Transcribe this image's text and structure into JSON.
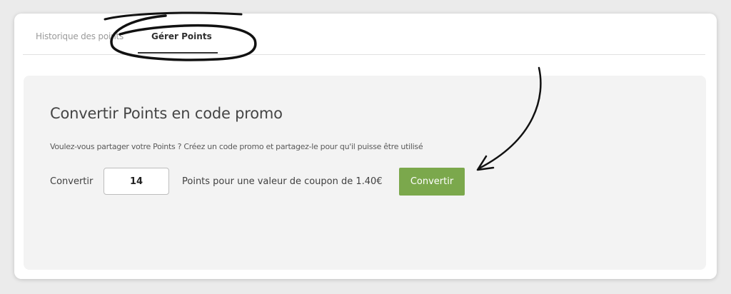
{
  "tabs": [
    {
      "label": "Historique des points",
      "active": false
    },
    {
      "label": "Gérer Points",
      "active": true
    }
  ],
  "panel": {
    "title": "Convertir Points en code promo",
    "description": "Voulez-vous partager votre Points ? Créez un code promo et partagez-le pour qu'il puisse être utilisé",
    "convert_label": "Convertir",
    "points_value": "14",
    "value_text": "Points pour une valeur de coupon de 1.40€",
    "button_label": "Convertir"
  },
  "colors": {
    "button": "#7ba84c",
    "panel_bg": "#f3f3f3",
    "annotation": "#111111"
  },
  "icons": {
    "tab_highlight": "hand-drawn-ellipse-icon",
    "pointer": "curved-arrow-icon"
  }
}
